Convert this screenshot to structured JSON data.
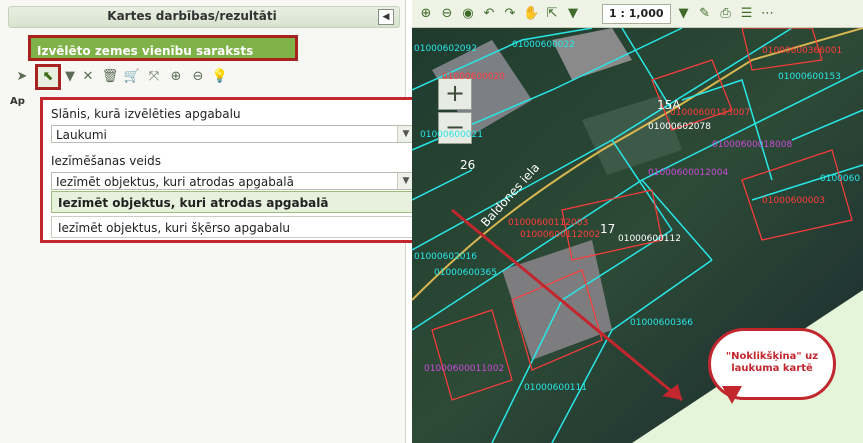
{
  "panel": {
    "title": "Kartes darbības/rezultāti",
    "section_header": "Izvēlēto zemes vienību saraksts",
    "tab_fragment": "Ap"
  },
  "popup": {
    "layer_label": "Slānis, kurā izvēlēties apgabalu",
    "layer_value": "Laukumi",
    "mode_label": "Iezīmēšanas veids",
    "mode_value": "Iezīmēt objektus, kuri atrodas apgabalā",
    "options": [
      "Iezīmēt objektus, kuri atrodas apgabalā",
      "Iezīmēt objektus, kuri šķērso apgabalu"
    ]
  },
  "map": {
    "scale": "1 : 1,000",
    "street_label": "Baldones iela",
    "house_numbers": [
      "15A",
      "17",
      "26"
    ],
    "parcel_ids_cyan": [
      "01000602092",
      "01000600022",
      "01000600153",
      "01000600021",
      "01000602078",
      "01000600112",
      "01000602016",
      "01000600365",
      "01000600366",
      "01000600111",
      "0100060"
    ],
    "parcel_ids_red": [
      "01000600153007",
      "01000600020",
      "01000600112002",
      "01000600112003",
      "01000600003",
      "01000600366001"
    ],
    "parcel_ids_purple": [
      "01000600012004",
      "01000600011002",
      "01000600018008"
    ],
    "callout_text": "\"Noklikšķina\" uz laukuma kartē"
  },
  "colors": {
    "header_green": "#7fb249",
    "highlight_red": "#c1272d",
    "parcel_cyan": "#29e6e6",
    "parcel_red": "#ff3b3b"
  }
}
